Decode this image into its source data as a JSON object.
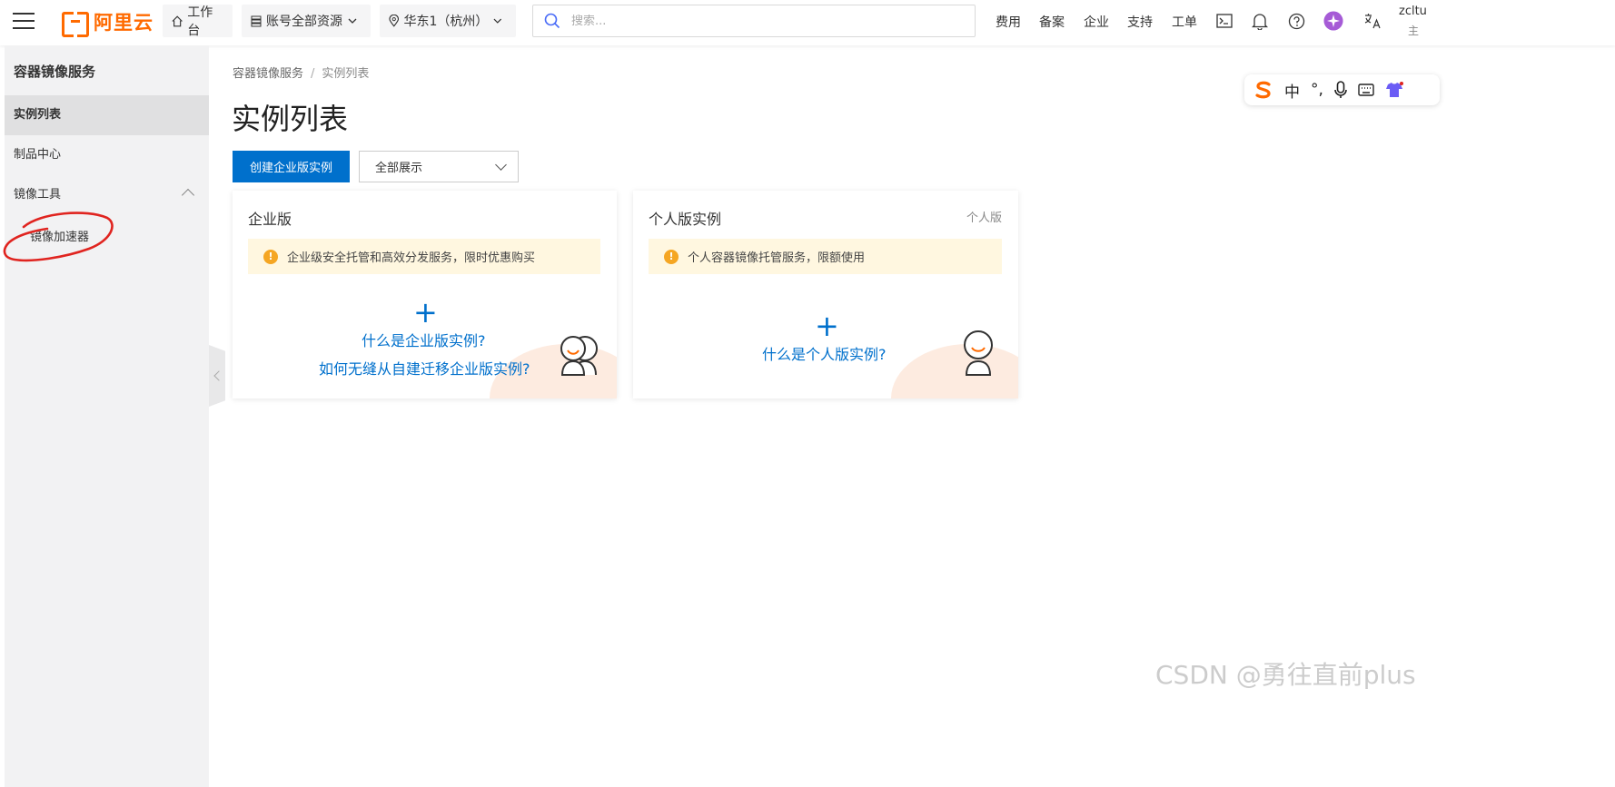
{
  "topbar": {
    "logo_text": "阿里云",
    "workbench": "工作台",
    "resources": "账号全部资源",
    "region": "华东1（杭州）",
    "search_placeholder": "搜索...",
    "nav": [
      "费用",
      "备案",
      "企业",
      "支持",
      "工单"
    ],
    "user_name": "zcltu",
    "user_sub": "主"
  },
  "sidebar": {
    "title": "容器镜像服务",
    "items": [
      {
        "label": "实例列表"
      },
      {
        "label": "制品中心"
      },
      {
        "label": "镜像工具"
      }
    ],
    "sub_item": "镜像加速器"
  },
  "main": {
    "breadcrumb": [
      "容器镜像服务",
      "/",
      "实例列表"
    ],
    "title": "实例列表",
    "create_button": "创建企业版实例",
    "filter_value": "全部展示",
    "enterprise_card": {
      "title": "企业版",
      "notice": "企业级安全托管和高效分发服务，限时优惠购买",
      "link1": "什么是企业版实例?",
      "link2": "如何无缝从自建迁移企业版实例?"
    },
    "personal_card": {
      "title": "个人版实例",
      "tag": "个人版",
      "notice": "个人容器镜像托管服务，限额使用",
      "link1": "什么是个人版实例?"
    }
  },
  "ime": {
    "items": [
      "中",
      "°,"
    ]
  },
  "watermark": "CSDN @勇往直前plus",
  "colors": {
    "accent": "#0070cc",
    "brand": "#ff6a00",
    "annotation": "#e0241f"
  }
}
